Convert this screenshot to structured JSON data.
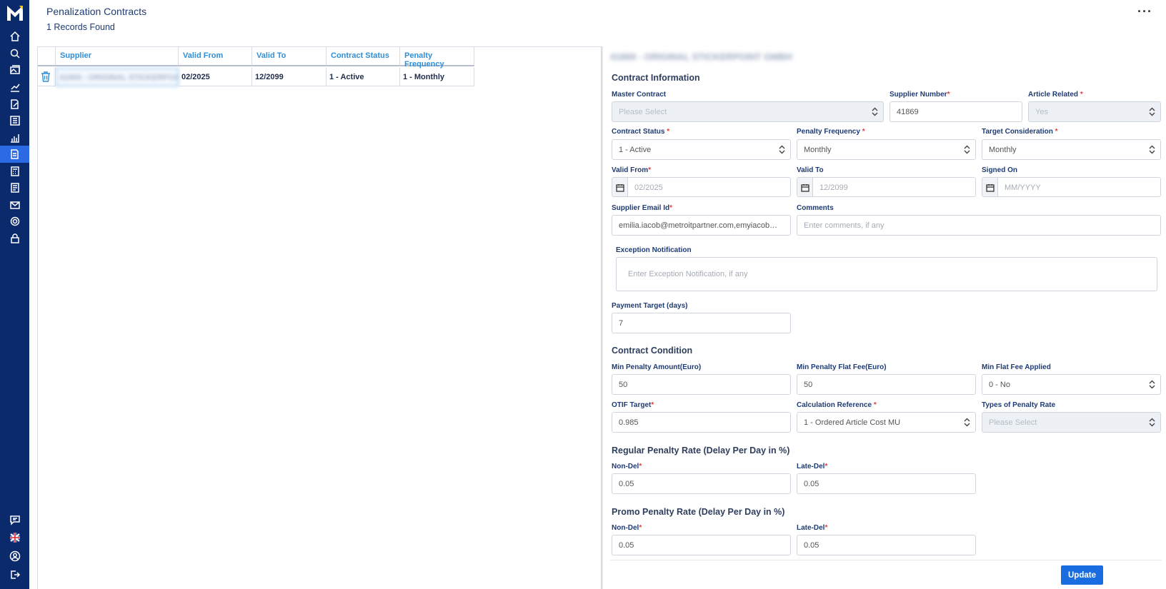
{
  "header": {
    "title": "Penalization Contracts",
    "records": "1 Records Found",
    "more": "···"
  },
  "grid": {
    "columns": [
      "Supplier",
      "Valid From",
      "Valid To",
      "Contract Status",
      "Penalty Frequency"
    ],
    "rows": [
      {
        "supplier": "41869 - ORIGINAL STICKERPOINT GMBH",
        "valid_from": "02/2025",
        "valid_to": "12/2099",
        "status": "1 - Active",
        "frequency": "1 - Monthly"
      }
    ]
  },
  "form": {
    "supplier_title": "41869 - ORIGINAL STICKERPOINT GMBH",
    "sections": {
      "contract_information": "Contract Information",
      "contract_condition": "Contract Condition",
      "regular_rate": "Regular Penalty Rate (Delay Per Day in %)",
      "promo_rate": "Promo Penalty Rate (Delay Per Day in %)"
    },
    "fields": {
      "master_contract": {
        "label": "Master Contract",
        "value": "Please Select"
      },
      "supplier_number": {
        "label": "Supplier Number",
        "value": "41869"
      },
      "article_related": {
        "label": "Article Related",
        "value": "Yes"
      },
      "contract_status": {
        "label": "Contract Status",
        "value": "1 - Active"
      },
      "penalty_frequency": {
        "label": "Penalty Frequency",
        "value": "Monthly"
      },
      "target_consideration": {
        "label": "Target Consideration",
        "value": "Monthly"
      },
      "valid_from": {
        "label": "Valid From",
        "value": "02/2025"
      },
      "valid_to": {
        "label": "Valid To",
        "value": "12/2099"
      },
      "signed_on": {
        "label": "Signed On",
        "placeholder": "MM/YYYY"
      },
      "supplier_email": {
        "label": "Supplier Email Id",
        "value": "emilia.iacob@metroitpartner.com,emyiacob@ya..."
      },
      "comments": {
        "label": "Comments",
        "placeholder": "Enter comments, if any"
      },
      "exception_notification": {
        "label": "Exception Notification",
        "placeholder": "Enter Exception Notification, if any"
      },
      "payment_target": {
        "label": "Payment Target (days)",
        "value": "7"
      },
      "min_penalty_amount": {
        "label": "Min Penalty Amount(Euro)",
        "value": "50"
      },
      "min_penalty_flat_fee": {
        "label": "Min Penalty Flat Fee(Euro)",
        "value": "50"
      },
      "min_flat_fee_applied": {
        "label": "Min Flat Fee Applied",
        "value": "0 - No"
      },
      "otif_target": {
        "label": "OTIF Target",
        "value": "0.985"
      },
      "calculation_reference": {
        "label": "Calculation Reference",
        "value": "1 - Ordered Article Cost MU"
      },
      "types_of_penalty_rate": {
        "label": "Types of Penalty Rate",
        "value": "Please Select"
      },
      "regular_non_del": {
        "label": "Non-Del",
        "value": "0.05"
      },
      "regular_late_del": {
        "label": "Late-Del",
        "value": "0.05"
      },
      "promo_non_del": {
        "label": "Non-Del",
        "value": "0.05"
      },
      "promo_late_del": {
        "label": "Late-Del",
        "value": "0.05"
      }
    },
    "required_mark": "*",
    "update_label": "Update"
  },
  "colors": {
    "sidebar": "#0b2a6b",
    "accent": "#1a6de0",
    "header_text": "#2f8fd8",
    "required": "#e23c3c"
  }
}
